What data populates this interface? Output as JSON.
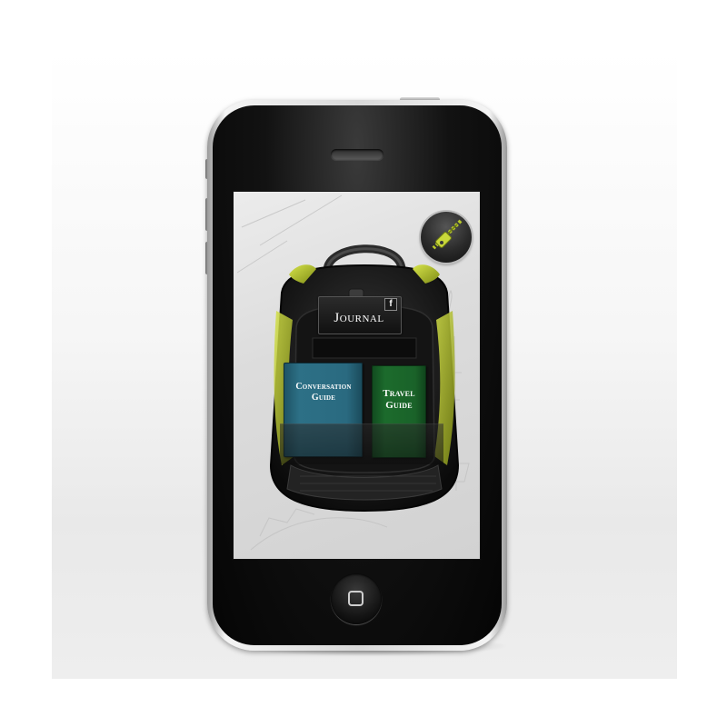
{
  "app": {
    "journal": {
      "label": "Journal",
      "social_icon": "facebook-icon",
      "social_glyph": "f"
    },
    "books": [
      {
        "id": "conversation",
        "title": "Conversation Guide",
        "color": "#2a6a80"
      },
      {
        "id": "travel",
        "title": "Travel Guide",
        "color": "#1c6b2c"
      }
    ],
    "zipper": {
      "icon": "zipper-icon",
      "accent": "#b7c92a"
    },
    "backpack": {
      "accent": "#b7c92a",
      "body": "#1b1b1b"
    }
  },
  "device": {
    "home_icon": "home-square-icon"
  }
}
